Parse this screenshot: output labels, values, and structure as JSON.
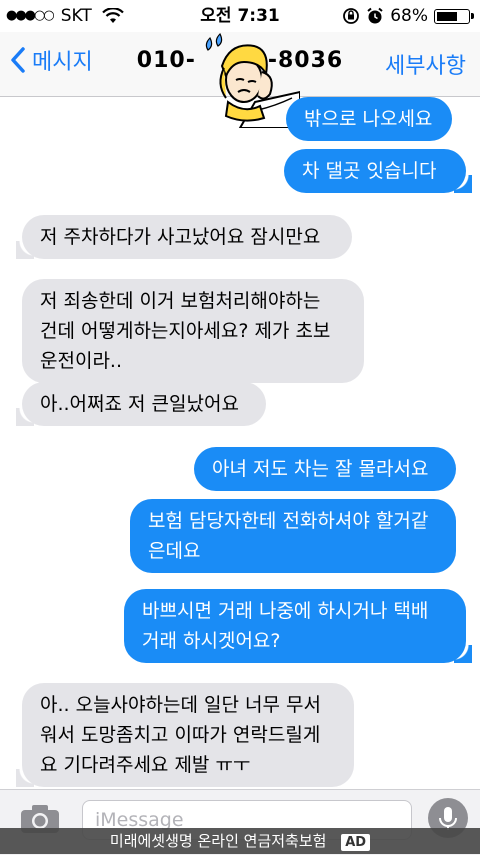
{
  "status": {
    "carrier": "SKT",
    "time": "오전 7:31",
    "battery": "68%",
    "battery_level": 0.68
  },
  "nav": {
    "back_label": "메시지",
    "title": "010-",
    "title_end": "-8036",
    "details_label": "세부사항"
  },
  "messages": [
    {
      "side": "sent",
      "text": "밖으로 나오세요"
    },
    {
      "side": "sent",
      "text": "차 댈곳 잇습니다"
    },
    {
      "side": "recv",
      "text": "저 주차하다가 사고났어요 잠시만요"
    },
    {
      "side": "recv",
      "text": "저 죄송한데 이거 보험처리해야하는\n건데 어떻게하는지아세요? 제가 초보\n운전이라.."
    },
    {
      "side": "recv",
      "text": "아..어쩌죠 저 큰일났어요"
    },
    {
      "side": "sent",
      "text": "아녀 저도 차는 잘 몰라서요"
    },
    {
      "side": "sent",
      "text": "보험 담당자한테 전화하셔야 할거같\n은데요"
    },
    {
      "side": "sent",
      "text": "바쁘시면 거래 나중에 하시거나 택배\n거래 하시겟어요?"
    },
    {
      "side": "recv",
      "text": "아.. 오늘사야하는데 일단 너무 무서\n워서 도망좀치고 이따가 연락드릴게\n요 기다려주세요 제발 ㅠㅜ"
    }
  ],
  "input": {
    "placeholder": "iMessage"
  },
  "ad": {
    "text": "미래에셋생명 온라인 연금저축보험",
    "badge": "AD"
  }
}
